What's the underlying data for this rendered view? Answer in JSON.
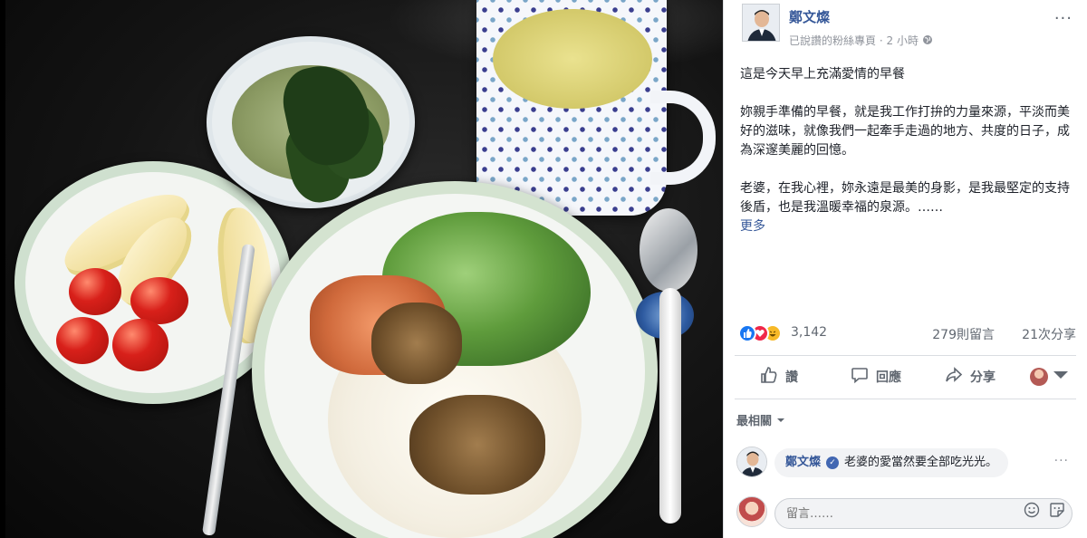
{
  "post": {
    "author": "鄭文燦",
    "meta_source": "已說讚的粉絲專頁",
    "meta_sep": "·",
    "meta_time": "2 小時",
    "more_menu": "···",
    "paragraph_1": "這是今天早上充滿愛情的早餐",
    "paragraph_2": "妳親手準備的早餐，就是我工作打拚的力量來源，平淡而美好的滋味，就像我們一起牽手走過的地方、共度的日子，成為深邃美麗的回憶。",
    "paragraph_3": "老婆，在我心裡，妳永遠是最美的身影，是我最堅定的支持後盾，也是我溫暖幸福的泉源。……",
    "see_more": "更多"
  },
  "engagement": {
    "reaction_count": "3,142",
    "comment_count": "279則留言",
    "share_count": "21次分享"
  },
  "actions": {
    "like": "讚",
    "comment": "回應",
    "share": "分享"
  },
  "comments": {
    "sort_label": "最相關",
    "items": [
      {
        "author": "鄭文燦",
        "text": "老婆的愛當然要全部吃光光。"
      }
    ]
  },
  "composer": {
    "placeholder": "留言……"
  },
  "colors": {
    "link_blue": "#365899",
    "like_blue": "#1877f2",
    "love_red": "#f02849",
    "haha_yellow": "#f7b928"
  },
  "icons": [
    "globe-icon",
    "like-icon",
    "comment-icon",
    "share-icon",
    "chevron-down-icon",
    "emoji-icon",
    "sticker-icon",
    "verified-icon"
  ]
}
